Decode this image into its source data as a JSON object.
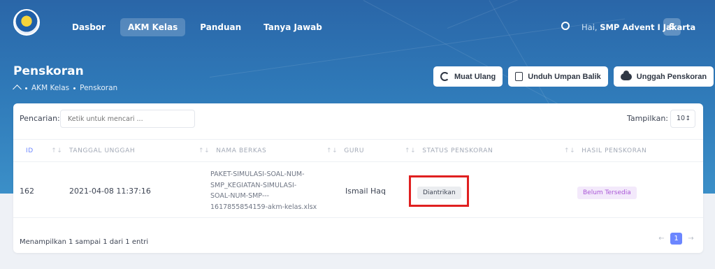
{
  "nav": {
    "items": [
      {
        "label": "Dasbor",
        "active": false
      },
      {
        "label": "AKM Kelas",
        "active": true
      },
      {
        "label": "Panduan",
        "active": false
      },
      {
        "label": "Tanya Jawab",
        "active": false
      }
    ],
    "greeting_prefix": "Hai,",
    "greeting_name": "SMP Advent I Jakarta",
    "avatar_initial": "S"
  },
  "header": {
    "title": "Penskoran",
    "breadcrumb": [
      "AKM Kelas",
      "Penskoran"
    ],
    "buttons": {
      "reload": "Muat Ulang",
      "download_feedback": "Unduh Umpan Balik",
      "upload_scoring": "Unggah Penskoran"
    }
  },
  "table": {
    "search_label": "Pencarian:",
    "search_placeholder": "Ketik untuk mencari ...",
    "show_label": "Tampilkan:",
    "show_value": "10",
    "columns": [
      "ID",
      "TANGGAL UNGGAH",
      "NAMA BERKAS",
      "GURU",
      "STATUS PENSKORAN",
      "HASIL PENSKORAN"
    ],
    "rows": [
      {
        "id": "162",
        "date": "2021-04-08 11:37:16",
        "filename_lines": [
          "PAKET-SIMULASI-SOAL-NUM-",
          "SMP_KEGIATAN-SIMULASI-",
          "SOAL-NUM-SMP---",
          "1617855854159-akm-kelas.xlsx"
        ],
        "teacher": "Ismail Haq",
        "status": "Diantrikan",
        "result": "Belum Tersedia"
      }
    ],
    "footer_info": "Menampilkan 1 sampai 1 dari 1 entri",
    "pager": {
      "prev": "←",
      "current": "1",
      "next": "→"
    }
  },
  "colors": {
    "hero": "#2f79b8",
    "accent": "#6b86ff",
    "highlight": "#e02020",
    "result_badge": "#a957d6"
  }
}
